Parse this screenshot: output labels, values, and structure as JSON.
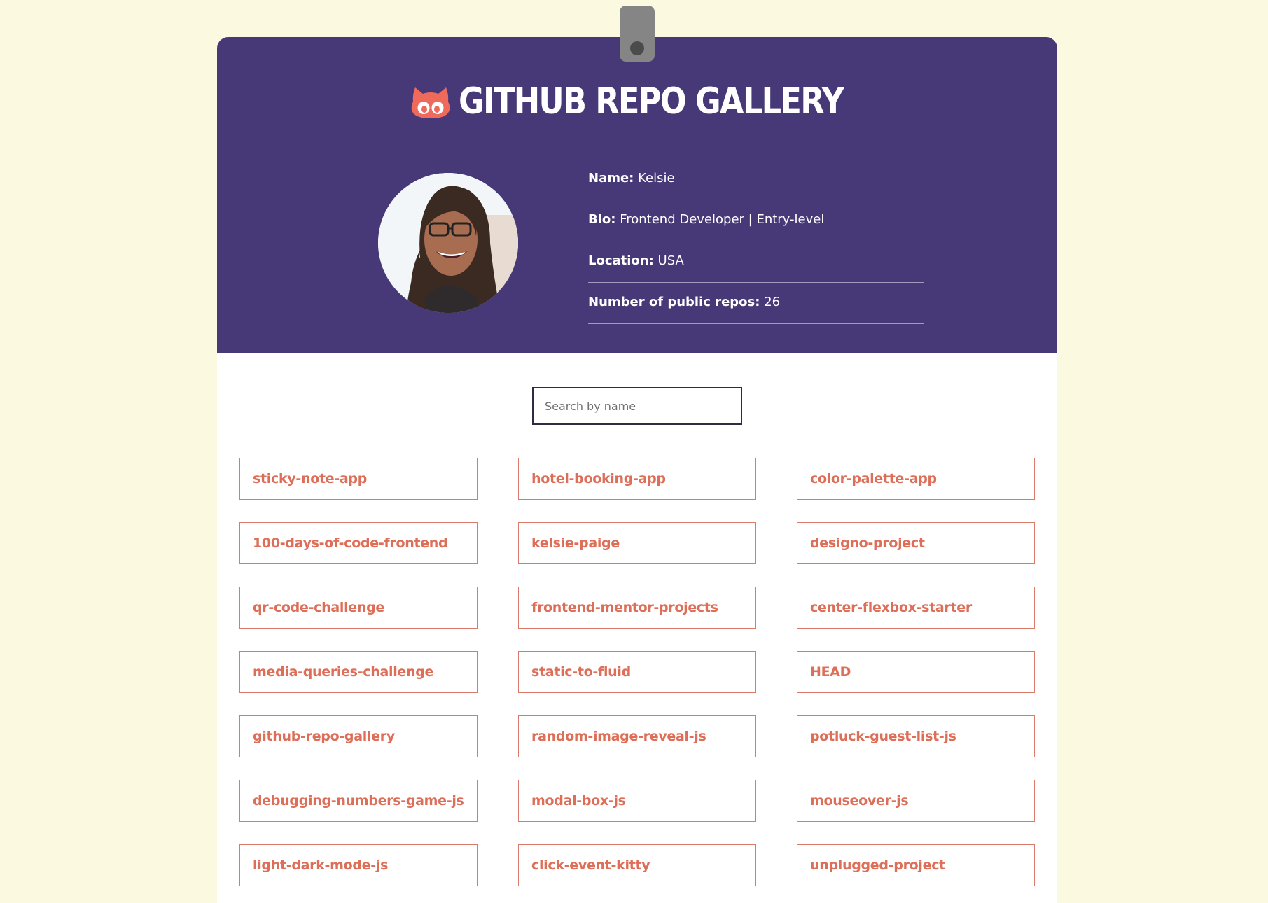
{
  "header": {
    "title": "GITHUB REPO GALLERY",
    "logo_icon": "github-octocat-icon",
    "background_color": "#473878",
    "logo_color": "#f06a5b"
  },
  "profile": {
    "avatar_alt": "avatar",
    "name_label": "Name:",
    "name_value": "Kelsie",
    "bio_label": "Bio:",
    "bio_value": "Frontend Developer | Entry-level",
    "location_label": "Location:",
    "location_value": "USA",
    "repos_label": "Number of public repos:",
    "repos_value": "26"
  },
  "search": {
    "placeholder": "Search by name",
    "value": ""
  },
  "repos": [
    {
      "name": "sticky-note-app"
    },
    {
      "name": "hotel-booking-app"
    },
    {
      "name": "color-palette-app"
    },
    {
      "name": "100-days-of-code-frontend"
    },
    {
      "name": "kelsie-paige"
    },
    {
      "name": "designo-project"
    },
    {
      "name": "qr-code-challenge"
    },
    {
      "name": "frontend-mentor-projects"
    },
    {
      "name": "center-flexbox-starter"
    },
    {
      "name": "media-queries-challenge"
    },
    {
      "name": "static-to-fluid"
    },
    {
      "name": "HEAD"
    },
    {
      "name": "github-repo-gallery"
    },
    {
      "name": "random-image-reveal-js"
    },
    {
      "name": "potluck-guest-list-js"
    },
    {
      "name": "debugging-numbers-game-js"
    },
    {
      "name": "modal-box-js"
    },
    {
      "name": "mouseover-js"
    },
    {
      "name": "light-dark-mode-js"
    },
    {
      "name": "click-event-kitty"
    },
    {
      "name": "unplugged-project"
    }
  ],
  "colors": {
    "page_background": "#fbf9e0",
    "repo_text": "#dd6e58",
    "repo_border": "#d97a6a"
  }
}
